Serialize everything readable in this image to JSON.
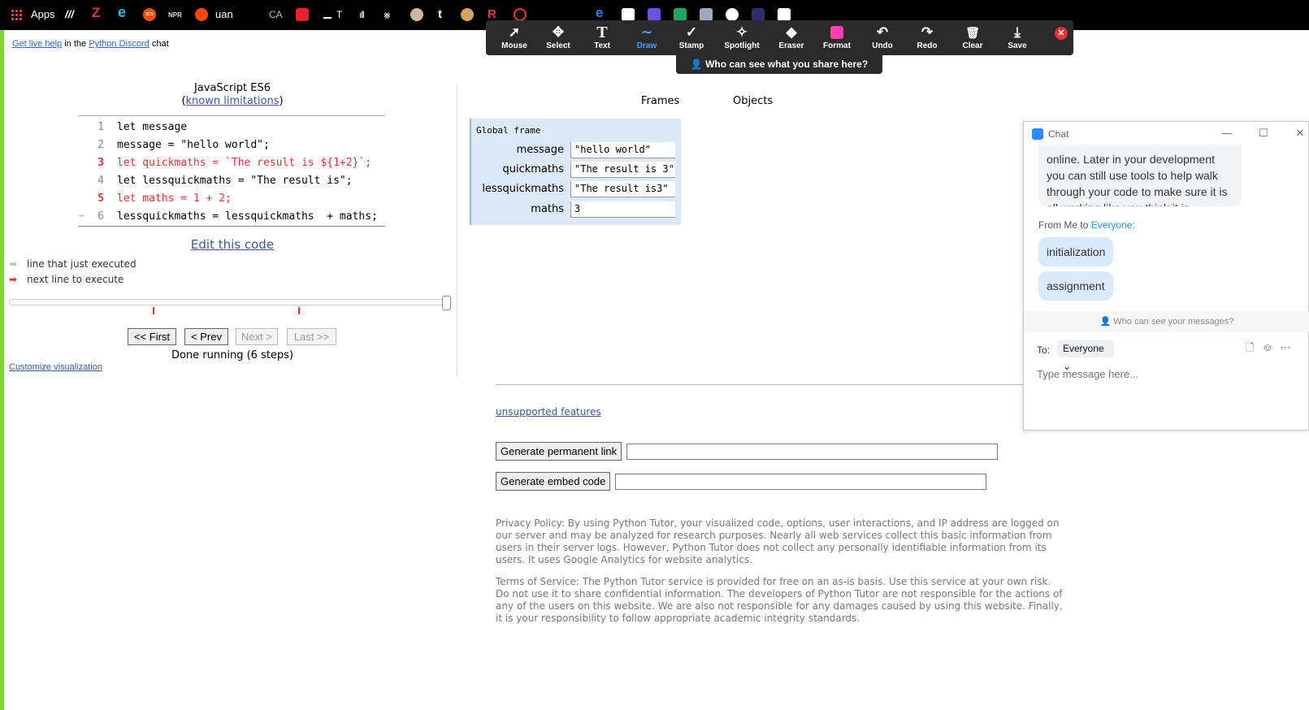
{
  "bookmarks": {
    "apps_label": "Apps",
    "items": [
      "///",
      "Z",
      "e",
      "ars",
      "NPR",
      "uan",
      "CA",
      "T",
      "R",
      "t",
      "e"
    ],
    "icons": [
      "zdnet-icon",
      "ie-icon",
      "ars-icon",
      "npr-icon",
      "reddit-icon",
      "ca-icon",
      "pencil-icon",
      "text-icon",
      "chart-icon",
      "xray-icon",
      "cloud-icon",
      "tumblr-icon",
      "cam-icon",
      "r-icon",
      "opera-icon",
      "bookmark-icon",
      "edge-icon",
      "pycharm-icon",
      "list-icon",
      "sheets-icon",
      "asp-icon",
      "globe-icon",
      "r-logo-icon",
      "sp-icon"
    ],
    "colors": {
      "bar": "#000000",
      "apps": "#e8453c"
    }
  },
  "toolbar": {
    "tools": [
      {
        "id": "mouse",
        "label": "Mouse",
        "glyph": "➚"
      },
      {
        "id": "select",
        "label": "Select",
        "glyph": "✥"
      },
      {
        "id": "text",
        "label": "Text",
        "glyph": "T"
      },
      {
        "id": "draw",
        "label": "Draw",
        "glyph": "∼"
      },
      {
        "id": "stamp",
        "label": "Stamp",
        "glyph": "✓"
      },
      {
        "id": "spotlight",
        "label": "Spotlight",
        "glyph": "✧"
      },
      {
        "id": "eraser",
        "label": "Eraser",
        "glyph": "◆"
      },
      {
        "id": "format",
        "label": "Format",
        "glyph": ""
      },
      {
        "id": "undo",
        "label": "Undo",
        "glyph": "↶"
      },
      {
        "id": "redo",
        "label": "Redo",
        "glyph": "↷"
      },
      {
        "id": "clear",
        "label": "Clear",
        "glyph": "🗑"
      },
      {
        "id": "save",
        "label": "Save",
        "glyph": "⤓"
      }
    ],
    "active_tool": "Draw",
    "share_banner": "Who can see what you share here?",
    "colors": {
      "background": "#2b2b2b",
      "active": "#4a9eff",
      "format": "#ff3fae",
      "close": "#e5322d"
    }
  },
  "page": {
    "live_help_link": "Get live help",
    "in_the": "in the",
    "discord_link": "Python Discord",
    "chat_word": "chat",
    "language": "JavaScript ES6",
    "paren_open": "(",
    "known_limitations": "known limitations",
    "paren_close": ")",
    "code_lines": [
      {
        "num": "1",
        "text": "let message",
        "red": false,
        "arrow": false
      },
      {
        "num": "2",
        "text": "message = \"hello world\";",
        "red": false,
        "arrow": false
      },
      {
        "num": "3",
        "text": "let quickmaths = `The result is ${1+2}`;",
        "red": true,
        "arrow": false
      },
      {
        "num": "4",
        "text": "let lessquickmaths = \"The result is\";",
        "red": false,
        "arrow": false
      },
      {
        "num": "5",
        "text": "let maths = 1 + 2;",
        "red": true,
        "arrow": false
      },
      {
        "num": "6",
        "text": "lessquickmaths = lessquickmaths  + maths;",
        "red": false,
        "arrow": true
      }
    ],
    "edit_code": "Edit this code",
    "legend_green": "line that just executed",
    "legend_red": "next line to execute",
    "buttons": {
      "first": "<< First",
      "prev": "< Prev",
      "next": "Next >",
      "last": "Last >>"
    },
    "done_running": "Done running (6 steps)",
    "customize": "Customize visualization",
    "frames_header": "Frames",
    "objects_header": "Objects",
    "global_frame": "Global frame",
    "variables": [
      {
        "name": "message",
        "value": "\"hello world\""
      },
      {
        "name": "quickmaths",
        "value": "\"The result is 3\""
      },
      {
        "name": "lessquickmaths",
        "value": "\"The result is3\""
      },
      {
        "name": "maths",
        "value": "3"
      }
    ],
    "unsupported": "unsupported features",
    "gen_link": "Generate permanent link",
    "gen_embed": "Generate embed code",
    "privacy": "Privacy Policy: By using Python Tutor, your visualized code, options, user interactions, and IP address are logged on our server and may be analyzed for research purposes. Nearly all web services collect this basic information from users in their server logs. However, Python Tutor does not collect any personally identifiable information from its users. It uses Google Analytics for website analytics.",
    "terms": "Terms of Service: The Python Tutor service is provided for free on an as-is basis. Use this service at your own risk. Do not use it to share confidential information. The developers of Python Tutor are not responsible for the actions of any of the users on this website. We are also not responsible for any damages caused by using this website. Finally, it is your responsibility to follow appropriate academic integrity standards.",
    "colors": {
      "link": "#3b5998",
      "red": "#ee3333",
      "green_arrow": "#a6d9a0",
      "frame_bg": "#dce9f6"
    }
  },
  "chat": {
    "title": "Chat",
    "message_partial": "online. Later in your development you can still use tools to help walk through your code to make sure it is all working like you think it is",
    "from_prefix": "From Me to",
    "from_target": "Everyone:",
    "pills": [
      "initialization",
      "assignment"
    ],
    "who_can_see": "Who can see your messages?",
    "to_label": "To:",
    "to_value": "Everyone",
    "placeholder": "Type message here...",
    "colors": {
      "accent": "#2d8cff",
      "pill": "#d9eafc"
    }
  }
}
